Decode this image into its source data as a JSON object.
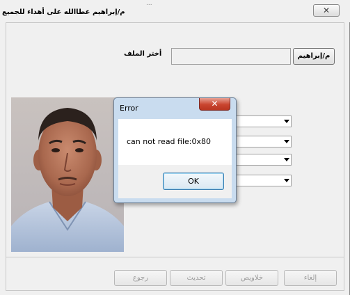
{
  "window": {
    "title": "م/إبراهيم عطاالله   على أهداء للجميع",
    "background_title": "...",
    "close_glyph": "✕"
  },
  "file_section": {
    "label": "أختر الملف",
    "path_value": "",
    "browse_label": "م/إبراهيم"
  },
  "dropdowns": [
    {
      "value": ""
    },
    {
      "value": ""
    },
    {
      "value": ""
    },
    {
      "value": ""
    }
  ],
  "buttons": {
    "cancel": "إلغاء",
    "cells": "خلاويص",
    "update": "تحديث",
    "back": "رجوع"
  },
  "dialog": {
    "title": "Error",
    "close_glyph": "✕",
    "message": "can not read file:0x80",
    "ok_label": "OK",
    "colors": {
      "frame": "#c9dcef",
      "close": "#c9452f"
    }
  }
}
